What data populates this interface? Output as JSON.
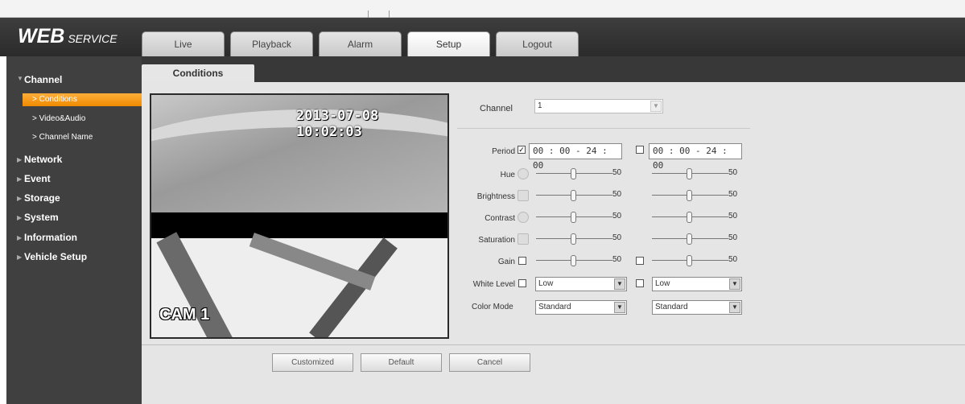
{
  "app": {
    "logo_main": "WEB",
    "logo_sub": "SERVICE"
  },
  "nav_tabs": [
    "Live",
    "Playback",
    "Alarm",
    "Setup",
    "Logout"
  ],
  "active_tab": "Setup",
  "sidebar": {
    "channel": "Channel",
    "channel_items": [
      "> Conditions",
      "> Video&Audio",
      "> Channel Name"
    ],
    "sections": [
      "Network",
      "Event",
      "Storage",
      "System",
      "Information",
      "Vehicle Setup"
    ]
  },
  "subtab": "Conditions",
  "preview": {
    "timestamp": "2013-07-08 10:02:03",
    "cam_label": "CAM 1"
  },
  "form": {
    "channel_label": "Channel",
    "channel_value": "1",
    "period_label": "Period",
    "period1": "00 : 00 - 24 : 00",
    "period2": "00 : 00 - 24 : 00",
    "hue_label": "Hue",
    "brightness_label": "Brightness",
    "contrast_label": "Contrast",
    "saturation_label": "Saturation",
    "gain_label": "Gain",
    "hue": {
      "left": "50",
      "right": "50"
    },
    "brightness": {
      "left": "50",
      "right": "50"
    },
    "contrast": {
      "left": "50",
      "right": "50"
    },
    "saturation": {
      "left": "50",
      "right": "50"
    },
    "gain": {
      "left": "50",
      "right": "50"
    },
    "white_level_label": "White Level",
    "white_level_left": "Low",
    "white_level_right": "Low",
    "color_mode_label": "Color Mode",
    "color_mode_left": "Standard",
    "color_mode_right": "Standard",
    "period1_checked": true,
    "period2_checked": false
  },
  "buttons": {
    "customized": "Customized",
    "default": "Default",
    "cancel": "Cancel"
  },
  "colors": {
    "accent": "#f39a12",
    "header": "#333333"
  }
}
